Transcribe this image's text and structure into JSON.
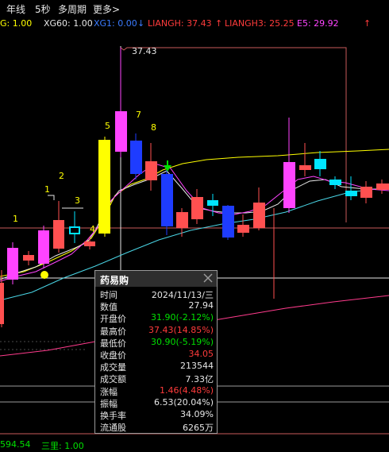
{
  "topbar": {
    "tabs": [
      "年线",
      "5秒",
      "多周期",
      "更多>"
    ]
  },
  "indicators": [
    {
      "label": "G: 1.00",
      "color": "#ffff00"
    },
    {
      "label": "XG60: 1.00",
      "color": "#e6e6e6"
    },
    {
      "label": "XG1: 0.00",
      "color": "#3a7bff"
    },
    {
      "label": "LIANGH: 37.43",
      "color": "#ff3b3b"
    },
    {
      "label": "LIANGH3: 25.25",
      "color": "#ff3b3b"
    },
    {
      "label": "E5: 29.92",
      "color": "#ff44ff"
    }
  ],
  "chart": {
    "price_marker": "37.43",
    "labels": [
      "1",
      "2",
      "3",
      "4",
      "5",
      "7",
      "8"
    ]
  },
  "tooltip": {
    "title": "药易购",
    "rows": [
      {
        "label": "时间",
        "value": "2024/11/13/三",
        "color": "#e6e6e6"
      },
      {
        "label": "数值",
        "value": "27.94",
        "color": "#e6e6e6"
      },
      {
        "label": "开盘价",
        "value": "31.90(-2.12%)",
        "color": "#00e000"
      },
      {
        "label": "最高价",
        "value": "37.43(14.85%)",
        "color": "#ff3b3b"
      },
      {
        "label": "最低价",
        "value": "30.90(-5.19%)",
        "color": "#00e000"
      },
      {
        "label": "收盘价",
        "value": "34.05",
        "color": "#ff3b3b"
      },
      {
        "label": "成交量",
        "value": "213544",
        "color": "#e6e6e6"
      },
      {
        "label": "成交额",
        "value": "7.33亿",
        "color": "#e6e6e6"
      },
      {
        "label": "涨幅",
        "value": "1.46(4.48%)",
        "color": "#ff3b3b"
      },
      {
        "label": "振幅",
        "value": "6.53(20.04%)",
        "color": "#e6e6e6"
      },
      {
        "label": "换手率",
        "value": "34.09%",
        "color": "#e6e6e6"
      },
      {
        "label": "流通股",
        "value": "6265万",
        "color": "#e6e6e6"
      }
    ]
  },
  "bottombar": {
    "left": "594.54",
    "right": "三里: 1.00"
  },
  "colors": {
    "up": "#ff5050",
    "down": "#00e5ff",
    "highlight": "#ff44ff",
    "yellow": "#ffff00",
    "blue": "#1e3cff"
  }
}
